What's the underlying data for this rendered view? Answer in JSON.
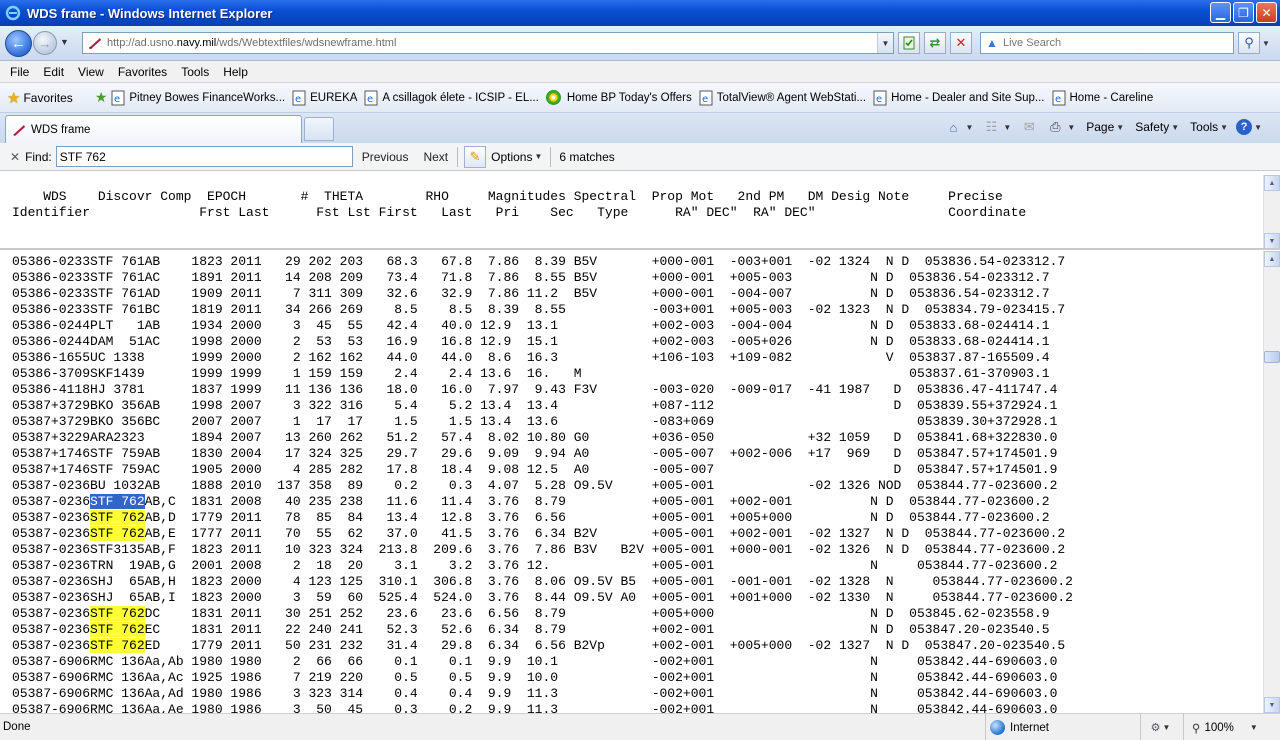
{
  "window": {
    "title": "WDS frame - Windows Internet Explorer",
    "minimize": "▁",
    "maximize": "❐",
    "close": "✕"
  },
  "address": {
    "url_prefix": "http://ad.usno.",
    "url_domain": "navy.mil",
    "url_suffix": "/wds/Webtextfiles/wdsnewframe.html",
    "search_placeholder": "Live Search"
  },
  "menu": [
    "File",
    "Edit",
    "View",
    "Favorites",
    "Tools",
    "Help"
  ],
  "favorites": {
    "label": "Favorites",
    "items": [
      "Pitney Bowes FinanceWorks...",
      "EUREKA",
      "A csillagok élete - ICSIP - EL...",
      "Home  BP Today's Offers",
      "TotalView® Agent WebStati...",
      "Home - Dealer and Site Sup...",
      "Home - Careline"
    ]
  },
  "tabs": {
    "active_title": "WDS frame"
  },
  "commandbar": {
    "page": "Page",
    "safety": "Safety",
    "tools": "Tools"
  },
  "find": {
    "label": "Find:",
    "value": "STF 762",
    "previous": "Previous",
    "next": "Next",
    "options": "Options",
    "matches": "6 matches"
  },
  "table_header": [
    "    WDS    Discovr Comp  EPOCH       #  THETA        RHO     Magnitudes Spectral  Prop Mot   2nd PM   DM Desig Note     Precise",
    "Identifier              Frst Last      Fst Lst First   Last   Pri    Sec   Type      RA\" DEC\"  RA\" DEC\"                 Coordinate"
  ],
  "search_term": "STF 762",
  "active_match_row": 15,
  "rows": [
    "05386-0233STF 761AB    1823 2011   29 202 203   68.3   67.8  7.86  8.39 B5V       +000-001  -003+001  -02 1324  N D  053836.54-023312.7",
    "05386-0233STF 761AC    1891 2011   14 208 209   73.4   71.8  7.86  8.55 B5V       +000-001  +005-003          N D  053836.54-023312.7",
    "05386-0233STF 761AD    1909 2011    7 311 309   32.6   32.9  7.86 11.2  B5V       +000-001  -004-007          N D  053836.54-023312.7",
    "05386-0233STF 761BC    1819 2011   34 266 269    8.5    8.5  8.39  8.55           -003+001  +005-003  -02 1323  N D  053834.79-023415.7",
    "05386-0244PLT   1AB    1934 2000    3  45  55   42.4   40.0 12.9  13.1            +002-003  -004-004          N D  053833.68-024414.1",
    "05386-0244DAM  51AC    1998 2000    2  53  53   16.9   16.8 12.9  15.1            +002-003  -005+026          N D  053833.68-024414.1",
    "05386-1655UC 1338      1999 2000    2 162 162   44.0   44.0  8.6  16.3            +106-103  +109-082            V  053837.87-165509.4",
    "05386-3709SKF1439      1999 1999    1 159 159    2.4    2.4 13.6  16.   M                                          053837.61-370903.1",
    "05386-4118HJ 3781      1837 1999   11 136 136   18.0   16.0  7.97  9.43 F3V       -003-020  -009-017  -41 1987   D  053836.47-411747.4",
    "05387+3729BKO 356AB    1998 2007    3 322 316    5.4    5.2 13.4  13.4            +087-112                       D  053839.55+372924.1",
    "05387+3729BKO 356BC    2007 2007    1  17  17    1.5    1.5 13.4  13.6            -083+069                          053839.30+372928.1",
    "05387+3229ARA2323      1894 2007   13 260 262   51.2   57.4  8.02 10.80 G0        +036-050            +32 1059   D  053841.68+322830.0",
    "05387+1746STF 759AB    1830 2004   17 324 325   29.7   29.6  9.09  9.94 A0        -005-007  +002-006  +17  969   D  053847.57+174501.9",
    "05387+1746STF 759AC    1905 2000    4 285 282   17.8   18.4  9.08 12.5  A0        -005-007                       D  053847.57+174501.9",
    "05387-0236BU 1032AB    1888 2010  137 358  89    0.2    0.3  4.07  5.28 O9.5V     +005-001            -02 1326 NOD  053844.77-023600.2",
    "05387-0236STF 762AB,C  1831 2008   40 235 238   11.6   11.4  3.76  8.79           +005-001  +002-001          N D  053844.77-023600.2",
    "05387-0236STF 762AB,D  1779 2011   78  85  84   13.4   12.8  3.76  6.56           +005-001  +005+000          N D  053844.77-023600.2",
    "05387-0236STF 762AB,E  1777 2011   70  55  62   37.0   41.5  3.76  6.34 B2V       +005-001  +002-001  -02 1327  N D  053844.77-023600.2",
    "05387-0236STF3135AB,F  1823 2011   10 323 324  213.8  209.6  3.76  7.86 B3V   B2V +005-001  +000-001  -02 1326  N D  053844.77-023600.2",
    "05387-0236TRN  19AB,G  2001 2008    2  18  20    3.1    3.2  3.76 12.             +005-001                    N     053844.77-023600.2",
    "05387-0236SHJ  65AB,H  1823 2000    4 123 125  310.1  306.8  3.76  8.06 O9.5V B5  +005-001  -001-001  -02 1328  N     053844.77-023600.2",
    "05387-0236SHJ  65AB,I  1823 2000    3  59  60  525.4  524.0  3.76  8.44 O9.5V A0  +005-001  +001+000  -02 1330  N     053844.77-023600.2",
    "05387-0236STF 762DC    1831 2011   30 251 252   23.6   23.6  6.56  8.79           +005+000                    N D  053845.62-023558.9",
    "05387-0236STF 762EC    1831 2011   22 240 241   52.3   52.6  6.34  8.79           +002-001                    N D  053847.20-023540.5",
    "05387-0236STF 762ED    1779 2011   50 231 232   31.4   29.8  6.34  6.56 B2Vp      +002-001  +005+000  -02 1327  N D  053847.20-023540.5",
    "05387-6906RMC 136Aa,Ab 1980 1980    2  66  66    0.1    0.1  9.9  10.1            -002+001                    N     053842.44-690603.0",
    "05387-6906RMC 136Aa,Ac 1925 1986    7 219 220    0.5    0.5  9.9  10.0            -002+001                    N     053842.44-690603.0",
    "05387-6906RMC 136Aa,Ad 1980 1986    3 323 314    0.4    0.4  9.9  11.3            -002+001                    N     053842.44-690603.0",
    "05387-6906RMC 136Aa,Ae 1980 1986    3  50  45    0.3    0.2  9.9  11.3            -002+001                    N     053842.44-690603.0"
  ],
  "status": {
    "text": "Done",
    "zone": "Internet",
    "zoom": "100%"
  },
  "colors": {
    "highlight": "#ffff33",
    "active_highlight": "#3166c6",
    "titlebar": "#0a4fd4"
  }
}
